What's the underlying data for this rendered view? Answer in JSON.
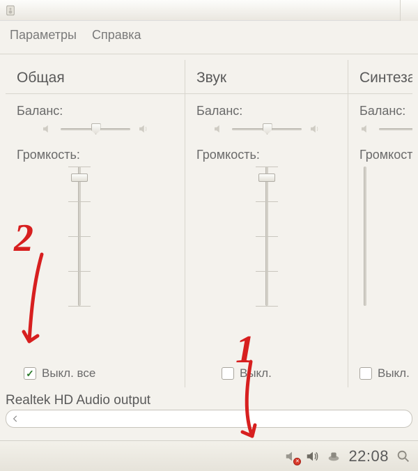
{
  "menu": {
    "items": [
      "Параметры",
      "Справка"
    ]
  },
  "channels": [
    {
      "title": "Общая",
      "balance_label": "Баланс:",
      "volume_label": "Громкость:",
      "mute_label": "Выкл. все",
      "mute_checked": true
    },
    {
      "title": "Звук",
      "balance_label": "Баланс:",
      "volume_label": "Громкость:",
      "mute_label": "Выкл.",
      "mute_checked": false
    },
    {
      "title": "Синтезато",
      "balance_label": "Баланс:",
      "volume_label": "Громкост",
      "mute_label": "Выкл.",
      "mute_checked": false
    }
  ],
  "device_label": "Realtek HD Audio output",
  "taskbar": {
    "clock": "22:08"
  },
  "annotations": {
    "n1": "1",
    "n2": "2"
  }
}
